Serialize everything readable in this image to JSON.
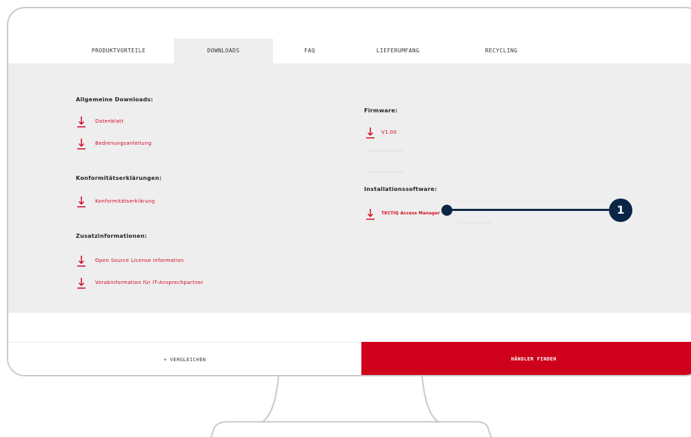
{
  "tabs": [
    {
      "label": "PRODUKTVORTEILE"
    },
    {
      "label": "DOWNLOADS"
    },
    {
      "label": "FAQ"
    },
    {
      "label": "LIEFERUMFANG"
    },
    {
      "label": "RECYCLING"
    }
  ],
  "active_tab": "DOWNLOADS",
  "left_column": {
    "general": {
      "title": "Allgemeine Downloads:",
      "items": [
        {
          "label": "Datenblatt"
        },
        {
          "label": "Bedienungsanleitung"
        }
      ]
    },
    "conformity": {
      "title": "Konformitätserklärungen:",
      "items": [
        {
          "label": "Konformitätserklärung"
        }
      ]
    },
    "additional": {
      "title": "Zusatzinformationen:",
      "items": [
        {
          "label": "Open Source License Information"
        },
        {
          "label": "Vorabinformation für IT-Ansprechpartner"
        }
      ]
    }
  },
  "right_column": {
    "firmware": {
      "title": "Firmware:",
      "items": [
        {
          "label": "V1.00"
        }
      ]
    },
    "installation": {
      "title": "Installationssoftware:",
      "items": [
        {
          "label": "TECTIQ Access Manager"
        }
      ]
    }
  },
  "footer": {
    "compare_label": "+ VERGLEICHEN",
    "dealer_label": "HÄNDLER FINDEN"
  },
  "callout": {
    "number": "1"
  },
  "colors": {
    "accent": "#d0021b",
    "panel_bg": "#eeeeee",
    "callout": "#0b2545",
    "frame": "#c9c9c9"
  },
  "icons": {
    "download": "download-arrow-icon"
  }
}
